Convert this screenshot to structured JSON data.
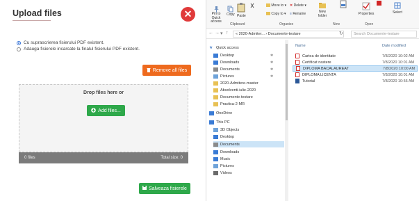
{
  "upload": {
    "title": "Upload files",
    "close_glyph": "✕",
    "options": [
      {
        "label": "Cu suprascrierea fisierului PDF existent.",
        "checked": true
      },
      {
        "label": "Adauga fisierele incarcate la finalul fisierului PDF existent.",
        "checked": false
      }
    ],
    "remove_all_label": "Remove all files",
    "drop_text": "Drop files here or",
    "add_files_label": "Add files...",
    "status_count": "0 files",
    "status_size": "Total size: 0",
    "save_label": "Salveaza fisierele",
    "colors": {
      "close": "#e03a3a",
      "remove": "#ee6a1e",
      "green": "#2ea84a"
    }
  },
  "explorer": {
    "ribbon": {
      "pin_label": "Pin to Quick access",
      "copy_label": "Copy",
      "paste_label": "Paste",
      "move_to_label": "Move to",
      "delete_label": "Delete",
      "copy_to_label": "Copy to",
      "rename_label": "Rename",
      "new_folder_label": "New folder",
      "properties_label": "Properties",
      "select_label": "Select",
      "groups": [
        "Clipboard",
        "Organize",
        "New",
        "Open"
      ]
    },
    "address": {
      "path": "« 2020-Admiter... › Documente-testare",
      "search_placeholder": "Search Documente-testare"
    },
    "nav": [
      {
        "label": "Quick access",
        "icon": "star-icon"
      },
      {
        "label": "Desktop",
        "icon": "desktop-icon",
        "pinned": true
      },
      {
        "label": "Downloads",
        "icon": "download-icon",
        "pinned": true
      },
      {
        "label": "Documents",
        "icon": "documents-icon",
        "pinned": true
      },
      {
        "label": "Pictures",
        "icon": "pictures-icon",
        "pinned": true
      },
      {
        "label": "2020-Admitere-master",
        "icon": "folder-icon"
      },
      {
        "label": "Absolventi-iulie-2020",
        "icon": "folder-icon"
      },
      {
        "label": "Documente-testare",
        "icon": "folder-icon"
      },
      {
        "label": "Practica-2-MR",
        "icon": "folder-icon"
      },
      {
        "label": "OneDrive",
        "icon": "cloud-icon"
      },
      {
        "label": "This PC",
        "icon": "pc-icon"
      },
      {
        "label": "3D Objects",
        "icon": "cube-icon"
      },
      {
        "label": "Desktop",
        "icon": "desktop-icon"
      },
      {
        "label": "Documents",
        "icon": "documents-icon",
        "selected": true
      },
      {
        "label": "Downloads",
        "icon": "download-icon"
      },
      {
        "label": "Music",
        "icon": "music-icon"
      },
      {
        "label": "Pictures",
        "icon": "pictures-icon"
      },
      {
        "label": "Videos",
        "icon": "videos-icon"
      }
    ],
    "columns": {
      "name": "Name",
      "date": "Date modified"
    },
    "files": [
      {
        "name": "Cartea de identitate",
        "date": "7/8/2020 10:02 AM",
        "type": "pdf"
      },
      {
        "name": "Certificat nastere",
        "date": "7/8/2020 10:01 AM",
        "type": "pdf"
      },
      {
        "name": "DIPLOMA BACALAUREAT",
        "date": "7/8/2020 10:00 AM",
        "type": "pdf",
        "selected": true
      },
      {
        "name": "DIPLOMA LICENTA",
        "date": "7/8/2020 10:01 AM",
        "type": "pdf"
      },
      {
        "name": "Tutorial",
        "date": "7/8/2020 10:56 AM",
        "type": "doc"
      }
    ]
  }
}
